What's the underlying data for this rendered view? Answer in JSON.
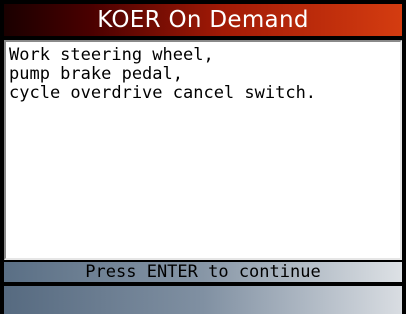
{
  "header": {
    "title": "KOER On Demand"
  },
  "content": {
    "lines": [
      "Work steering wheel,",
      "pump brake pedal,",
      "cycle overdrive cancel switch."
    ]
  },
  "status": {
    "prompt": "Press ENTER to continue"
  },
  "colors": {
    "title_bar": "#a21a06",
    "status_bar": "#8796a6",
    "background": "#000000"
  }
}
